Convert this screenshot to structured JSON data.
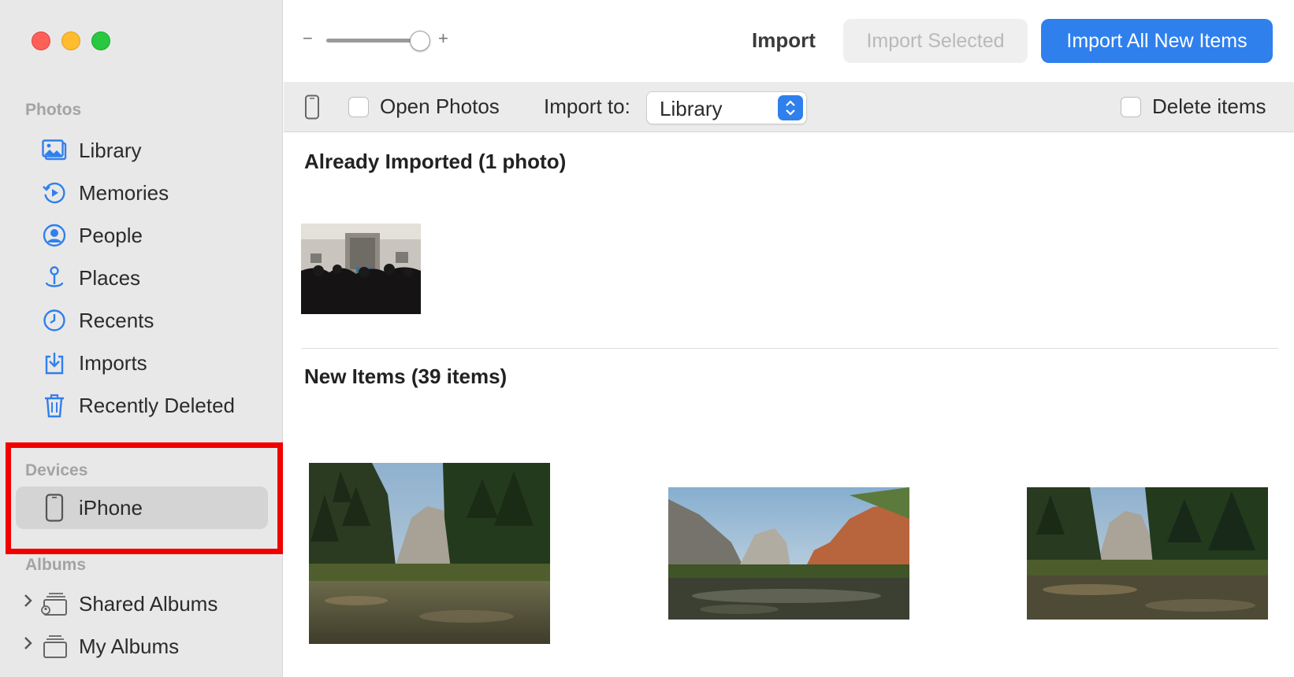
{
  "window": {
    "traffic_lights": [
      "close",
      "minimize",
      "zoom"
    ]
  },
  "sidebar": {
    "photos_title": "Photos",
    "photos_items": [
      {
        "label": "Library",
        "icon": "photo-library-icon"
      },
      {
        "label": "Memories",
        "icon": "memories-icon"
      },
      {
        "label": "People",
        "icon": "people-icon"
      },
      {
        "label": "Places",
        "icon": "places-pin-icon"
      },
      {
        "label": "Recents",
        "icon": "clock-icon"
      },
      {
        "label": "Imports",
        "icon": "import-tray-icon"
      },
      {
        "label": "Recently Deleted",
        "icon": "trash-icon"
      }
    ],
    "devices_title": "Devices",
    "device_item": {
      "label": "iPhone",
      "icon": "iphone-icon",
      "selected": true
    },
    "albums_title": "Albums",
    "albums_items": [
      {
        "label": "Shared Albums",
        "icon": "shared-albums-icon"
      },
      {
        "label": "My Albums",
        "icon": "albums-stack-icon"
      }
    ]
  },
  "toolbar": {
    "zoom_minus": "−",
    "zoom_plus": "+",
    "zoom_level": 0.85,
    "title": "Import",
    "import_selected_label": "Import Selected",
    "import_all_label": "Import All New Items"
  },
  "options_bar": {
    "open_photos_label": "Open Photos",
    "open_photos_checked": false,
    "import_to_label": "Import to:",
    "import_to_value": "Library",
    "delete_items_label": "Delete items",
    "delete_items_checked": false
  },
  "content": {
    "already_imported_heading": "Already Imported (1 photo)",
    "new_items_heading": "New Items (39 items)"
  },
  "colors": {
    "accent": "#2f80ed",
    "highlight_box": "#f20000",
    "sidebar_bg": "#e9e8e8"
  }
}
